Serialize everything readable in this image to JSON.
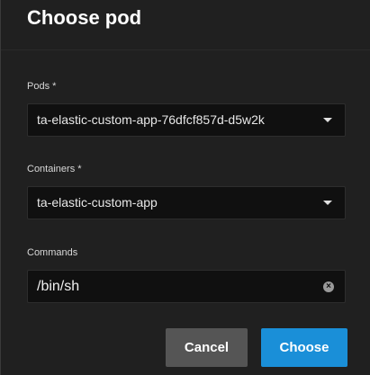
{
  "dialog": {
    "title": "Choose pod"
  },
  "pods": {
    "label": "Pods *",
    "value": "ta-elastic-custom-app-76dfcf857d-d5w2k",
    "icon": "dropdown-arrow-icon"
  },
  "containers": {
    "label": "Containers *",
    "value": "ta-elastic-custom-app",
    "icon": "dropdown-arrow-icon"
  },
  "commands": {
    "label": "Commands",
    "value": "/bin/sh",
    "icon": "clear-icon"
  },
  "buttons": {
    "cancel": "Cancel",
    "choose": "Choose"
  },
  "colors": {
    "background": "#202020",
    "field_background": "#101010",
    "cancel_button": "#555555",
    "primary_button": "#1a8fd8"
  }
}
